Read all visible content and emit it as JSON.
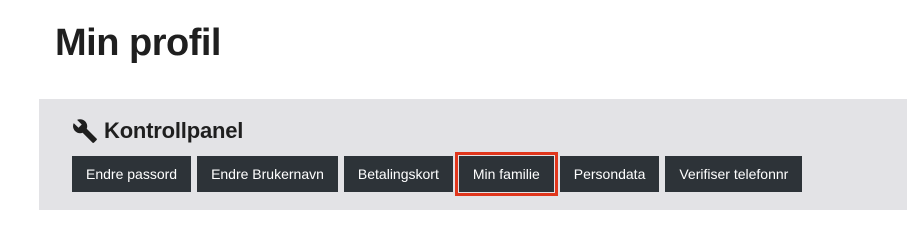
{
  "page": {
    "title": "Min profil"
  },
  "panel": {
    "title": "Kontrollpanel",
    "icon": "wrench-icon",
    "buttons": [
      {
        "label": "Endre passord"
      },
      {
        "label": "Endre Brukernavn"
      },
      {
        "label": "Betalingskort"
      },
      {
        "label": "Min familie",
        "highlighted": true
      },
      {
        "label": "Persondata"
      },
      {
        "label": "Verifiser telefonnr"
      }
    ]
  },
  "colors": {
    "button_bg": "#2d3338",
    "panel_bg": "#e3e3e6",
    "highlight": "#e0361c"
  }
}
